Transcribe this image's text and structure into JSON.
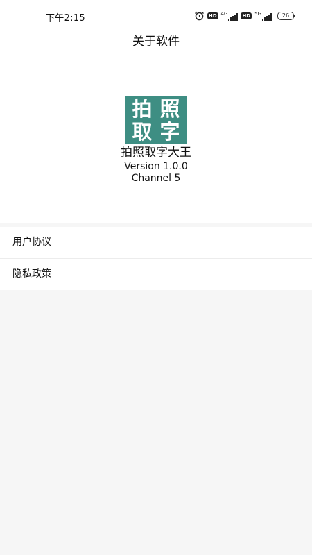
{
  "status_bar": {
    "time": "下午2:15",
    "hd_1": "HD",
    "network_1": "4G",
    "hd_2": "HD",
    "network_2": "5G",
    "battery": "26",
    "icons": [
      "alarm-icon",
      "hd-icon",
      "signal-icon",
      "hd-icon",
      "signal-icon",
      "battery-icon"
    ]
  },
  "header": {
    "title": "关于软件"
  },
  "app_info": {
    "logo_chars": [
      "拍",
      "照",
      "取",
      "字"
    ],
    "logo_color": "#3e8e83",
    "name": "拍照取字大王",
    "version": "Version 1.0.0",
    "channel": "Channel 5"
  },
  "menu": {
    "items": [
      {
        "label": "用户协议"
      },
      {
        "label": "隐私政策"
      }
    ]
  }
}
